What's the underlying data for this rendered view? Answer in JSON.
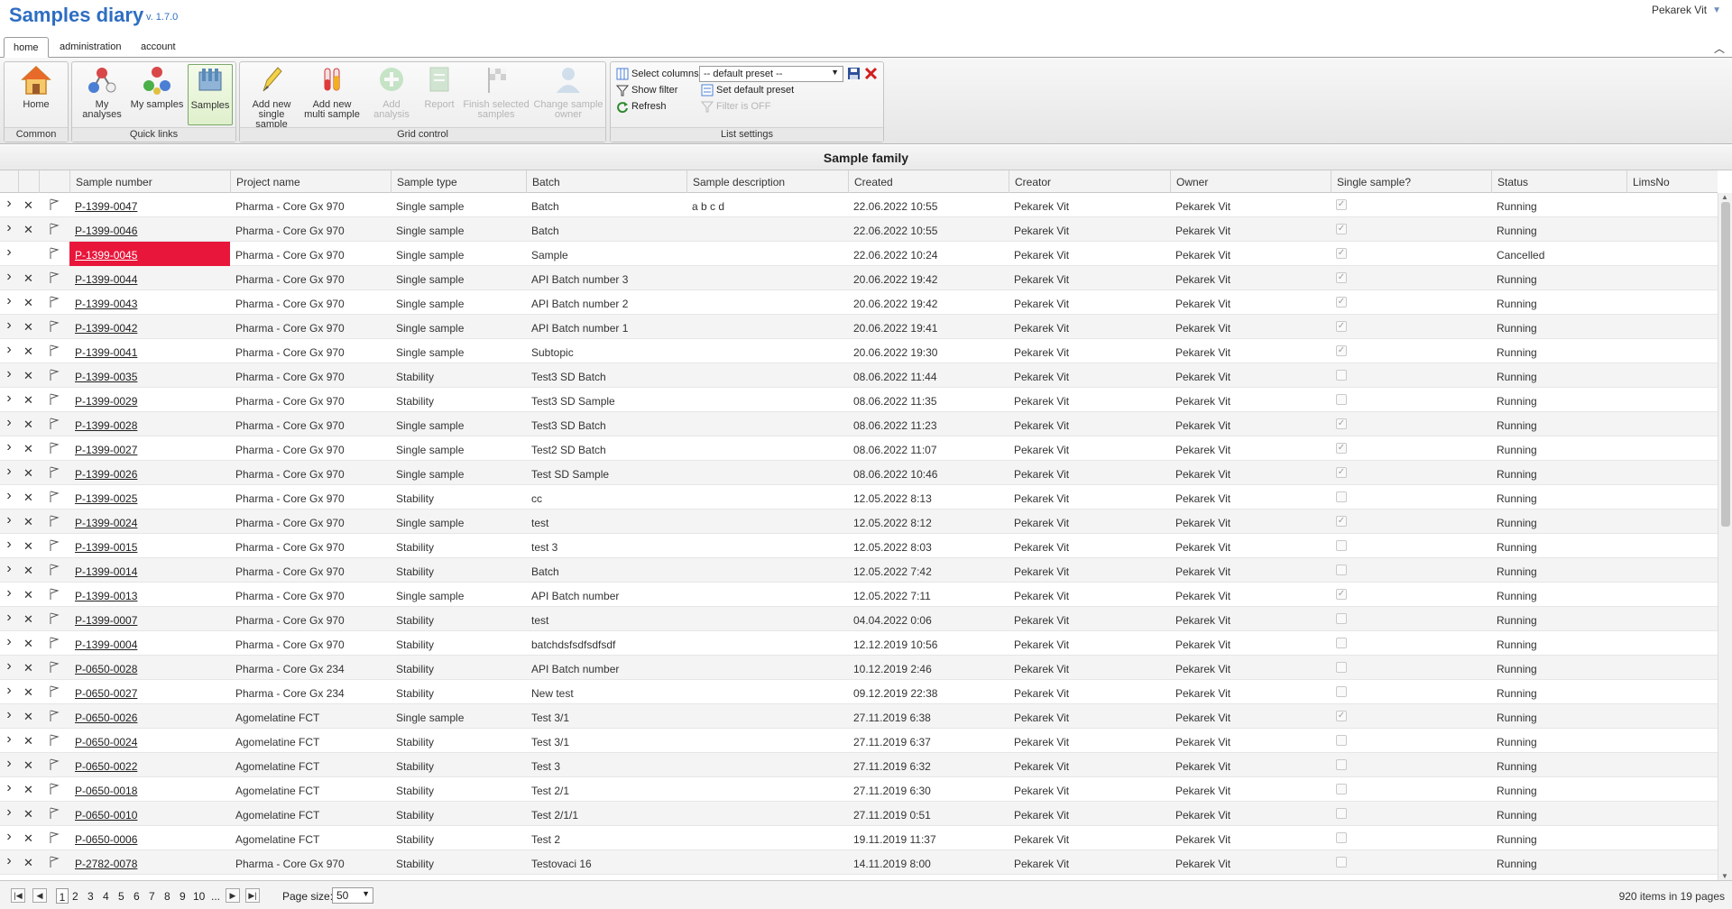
{
  "app": {
    "title": "Samples diary",
    "version": "v. 1.7.0",
    "user": "Pekarek Vit"
  },
  "tabs": [
    "home",
    "administration",
    "account"
  ],
  "ribbon": {
    "common": {
      "label": "Common",
      "home": "Home"
    },
    "quick_links": {
      "label": "Quick links",
      "my_analyses": "My analyses",
      "my_samples": "My samples",
      "samples": "Samples"
    },
    "grid_control": {
      "label": "Grid control",
      "add_single": [
        "Add new",
        "single sample"
      ],
      "add_multi": [
        "Add new",
        "multi sample"
      ],
      "add_analysis": "Add analysis",
      "report": "Report",
      "finish": [
        "Finish selected",
        "samples"
      ],
      "change_owner": [
        "Change sample",
        "owner"
      ]
    },
    "list_settings": {
      "label": "List settings",
      "select_columns": "Select columns",
      "preset": "-- default preset --",
      "show_filter": "Show filter",
      "set_default_preset": "Set default preset",
      "refresh": "Refresh",
      "filter_off": "Filter is OFF"
    }
  },
  "grid": {
    "caption": "Sample family",
    "columns": [
      "Sample number",
      "Project name",
      "Sample type",
      "Batch",
      "Sample description",
      "Created",
      "Creator",
      "Owner",
      "Single sample?",
      "Status",
      "LimsNo"
    ],
    "rows": [
      {
        "num": "P-1399-0047",
        "project": "Pharma - Core Gx 970",
        "type": "Single sample",
        "batch": "Batch",
        "desc": "a b c d",
        "created": "22.06.2022 10:55",
        "creator": "Pekarek Vit",
        "owner": "Pekarek Vit",
        "single": true,
        "status": "Running",
        "del": true
      },
      {
        "num": "P-1399-0046",
        "project": "Pharma - Core Gx 970",
        "type": "Single sample",
        "batch": "Batch",
        "desc": "",
        "created": "22.06.2022 10:55",
        "creator": "Pekarek Vit",
        "owner": "Pekarek Vit",
        "single": true,
        "status": "Running",
        "del": true
      },
      {
        "num": "P-1399-0045",
        "project": "Pharma - Core Gx 970",
        "type": "Single sample",
        "batch": "Sample",
        "desc": "",
        "created": "22.06.2022 10:24",
        "creator": "Pekarek Vit",
        "owner": "Pekarek Vit",
        "single": true,
        "status": "Cancelled",
        "del": false,
        "highlight": true
      },
      {
        "num": "P-1399-0044",
        "project": "Pharma - Core Gx 970",
        "type": "Single sample",
        "batch": "API Batch number 3",
        "desc": "",
        "created": "20.06.2022 19:42",
        "creator": "Pekarek Vit",
        "owner": "Pekarek Vit",
        "single": true,
        "status": "Running",
        "del": true
      },
      {
        "num": "P-1399-0043",
        "project": "Pharma - Core Gx 970",
        "type": "Single sample",
        "batch": "API Batch number 2",
        "desc": "",
        "created": "20.06.2022 19:42",
        "creator": "Pekarek Vit",
        "owner": "Pekarek Vit",
        "single": true,
        "status": "Running",
        "del": true
      },
      {
        "num": "P-1399-0042",
        "project": "Pharma - Core Gx 970",
        "type": "Single sample",
        "batch": "API Batch number 1",
        "desc": "",
        "created": "20.06.2022 19:41",
        "creator": "Pekarek Vit",
        "owner": "Pekarek Vit",
        "single": true,
        "status": "Running",
        "del": true
      },
      {
        "num": "P-1399-0041",
        "project": "Pharma - Core Gx 970",
        "type": "Single sample",
        "batch": "Subtopic",
        "desc": "",
        "created": "20.06.2022 19:30",
        "creator": "Pekarek Vit",
        "owner": "Pekarek Vit",
        "single": true,
        "status": "Running",
        "del": true
      },
      {
        "num": "P-1399-0035",
        "project": "Pharma - Core Gx 970",
        "type": "Stability",
        "batch": "Test3 SD Batch",
        "desc": "",
        "created": "08.06.2022 11:44",
        "creator": "Pekarek Vit",
        "owner": "Pekarek Vit",
        "single": false,
        "status": "Running",
        "del": true
      },
      {
        "num": "P-1399-0029",
        "project": "Pharma - Core Gx 970",
        "type": "Stability",
        "batch": "Test3 SD Sample",
        "desc": "",
        "created": "08.06.2022 11:35",
        "creator": "Pekarek Vit",
        "owner": "Pekarek Vit",
        "single": false,
        "status": "Running",
        "del": true
      },
      {
        "num": "P-1399-0028",
        "project": "Pharma - Core Gx 970",
        "type": "Single sample",
        "batch": "Test3 SD Batch",
        "desc": "",
        "created": "08.06.2022 11:23",
        "creator": "Pekarek Vit",
        "owner": "Pekarek Vit",
        "single": true,
        "status": "Running",
        "del": true
      },
      {
        "num": "P-1399-0027",
        "project": "Pharma - Core Gx 970",
        "type": "Single sample",
        "batch": "Test2 SD Batch",
        "desc": "",
        "created": "08.06.2022 11:07",
        "creator": "Pekarek Vit",
        "owner": "Pekarek Vit",
        "single": true,
        "status": "Running",
        "del": true
      },
      {
        "num": "P-1399-0026",
        "project": "Pharma - Core Gx 970",
        "type": "Single sample",
        "batch": "Test SD Sample",
        "desc": "",
        "created": "08.06.2022 10:46",
        "creator": "Pekarek Vit",
        "owner": "Pekarek Vit",
        "single": true,
        "status": "Running",
        "del": true
      },
      {
        "num": "P-1399-0025",
        "project": "Pharma - Core Gx 970",
        "type": "Stability",
        "batch": "cc",
        "desc": "",
        "created": "12.05.2022 8:13",
        "creator": "Pekarek Vit",
        "owner": "Pekarek Vit",
        "single": false,
        "status": "Running",
        "del": true
      },
      {
        "num": "P-1399-0024",
        "project": "Pharma - Core Gx 970",
        "type": "Single sample",
        "batch": "test",
        "desc": "",
        "created": "12.05.2022 8:12",
        "creator": "Pekarek Vit",
        "owner": "Pekarek Vit",
        "single": true,
        "status": "Running",
        "del": true
      },
      {
        "num": "P-1399-0015",
        "project": "Pharma - Core Gx 970",
        "type": "Stability",
        "batch": "test 3",
        "desc": "",
        "created": "12.05.2022 8:03",
        "creator": "Pekarek Vit",
        "owner": "Pekarek Vit",
        "single": false,
        "status": "Running",
        "del": true
      },
      {
        "num": "P-1399-0014",
        "project": "Pharma - Core Gx 970",
        "type": "Stability",
        "batch": "Batch",
        "desc": "",
        "created": "12.05.2022 7:42",
        "creator": "Pekarek Vit",
        "owner": "Pekarek Vit",
        "single": false,
        "status": "Running",
        "del": true
      },
      {
        "num": "P-1399-0013",
        "project": "Pharma - Core Gx 970",
        "type": "Single sample",
        "batch": "API Batch number",
        "desc": "",
        "created": "12.05.2022 7:11",
        "creator": "Pekarek Vit",
        "owner": "Pekarek Vit",
        "single": true,
        "status": "Running",
        "del": true
      },
      {
        "num": "P-1399-0007",
        "project": "Pharma - Core Gx 970",
        "type": "Stability",
        "batch": "test",
        "desc": "",
        "created": "04.04.2022 0:06",
        "creator": "Pekarek Vit",
        "owner": "Pekarek Vit",
        "single": false,
        "status": "Running",
        "del": true
      },
      {
        "num": "P-1399-0004",
        "project": "Pharma - Core Gx 970",
        "type": "Stability",
        "batch": "batchdsfsdfsdfsdf",
        "desc": "",
        "created": "12.12.2019 10:56",
        "creator": "Pekarek Vit",
        "owner": "Pekarek Vit",
        "single": false,
        "status": "Running",
        "del": true
      },
      {
        "num": "P-0650-0028",
        "project": "Pharma - Core Gx 234",
        "type": "Stability",
        "batch": "API Batch number",
        "desc": "",
        "created": "10.12.2019 2:46",
        "creator": "Pekarek Vit",
        "owner": "Pekarek Vit",
        "single": false,
        "status": "Running",
        "del": true
      },
      {
        "num": "P-0650-0027",
        "project": "Pharma - Core Gx 234",
        "type": "Stability",
        "batch": "New test",
        "desc": "",
        "created": "09.12.2019 22:38",
        "creator": "Pekarek Vit",
        "owner": "Pekarek Vit",
        "single": false,
        "status": "Running",
        "del": true
      },
      {
        "num": "P-0650-0026",
        "project": "Agomelatine FCT",
        "type": "Single sample",
        "batch": "Test 3/1",
        "desc": "",
        "created": "27.11.2019 6:38",
        "creator": "Pekarek Vit",
        "owner": "Pekarek Vit",
        "single": true,
        "status": "Running",
        "del": true
      },
      {
        "num": "P-0650-0024",
        "project": "Agomelatine FCT",
        "type": "Stability",
        "batch": "Test 3/1",
        "desc": "",
        "created": "27.11.2019 6:37",
        "creator": "Pekarek Vit",
        "owner": "Pekarek Vit",
        "single": false,
        "status": "Running",
        "del": true
      },
      {
        "num": "P-0650-0022",
        "project": "Agomelatine FCT",
        "type": "Stability",
        "batch": "Test 3",
        "desc": "",
        "created": "27.11.2019 6:32",
        "creator": "Pekarek Vit",
        "owner": "Pekarek Vit",
        "single": false,
        "status": "Running",
        "del": true
      },
      {
        "num": "P-0650-0018",
        "project": "Agomelatine FCT",
        "type": "Stability",
        "batch": "Test 2/1",
        "desc": "",
        "created": "27.11.2019 6:30",
        "creator": "Pekarek Vit",
        "owner": "Pekarek Vit",
        "single": false,
        "status": "Running",
        "del": true
      },
      {
        "num": "P-0650-0010",
        "project": "Agomelatine FCT",
        "type": "Stability",
        "batch": "Test 2/1/1",
        "desc": "",
        "created": "27.11.2019 0:51",
        "creator": "Pekarek Vit",
        "owner": "Pekarek Vit",
        "single": false,
        "status": "Running",
        "del": true
      },
      {
        "num": "P-0650-0006",
        "project": "Agomelatine FCT",
        "type": "Stability",
        "batch": "Test 2",
        "desc": "",
        "created": "19.11.2019 11:37",
        "creator": "Pekarek Vit",
        "owner": "Pekarek Vit",
        "single": false,
        "status": "Running",
        "del": true
      },
      {
        "num": "P-2782-0078",
        "project": "Pharma - Core Gx 970",
        "type": "Stability",
        "batch": "Testovaci 16",
        "desc": "",
        "created": "14.11.2019 8:00",
        "creator": "Pekarek Vit",
        "owner": "Pekarek Vit",
        "single": false,
        "status": "Running",
        "del": true
      }
    ]
  },
  "pager": {
    "pages": [
      "1",
      "2",
      "3",
      "4",
      "5",
      "6",
      "7",
      "8",
      "9",
      "10",
      "..."
    ],
    "current": "1",
    "page_size_label": "Page size:",
    "page_size": "50",
    "summary": "920 items in 19 pages"
  },
  "colors": {
    "accent": "#2e6ec2",
    "highlight": "#e8163a"
  }
}
